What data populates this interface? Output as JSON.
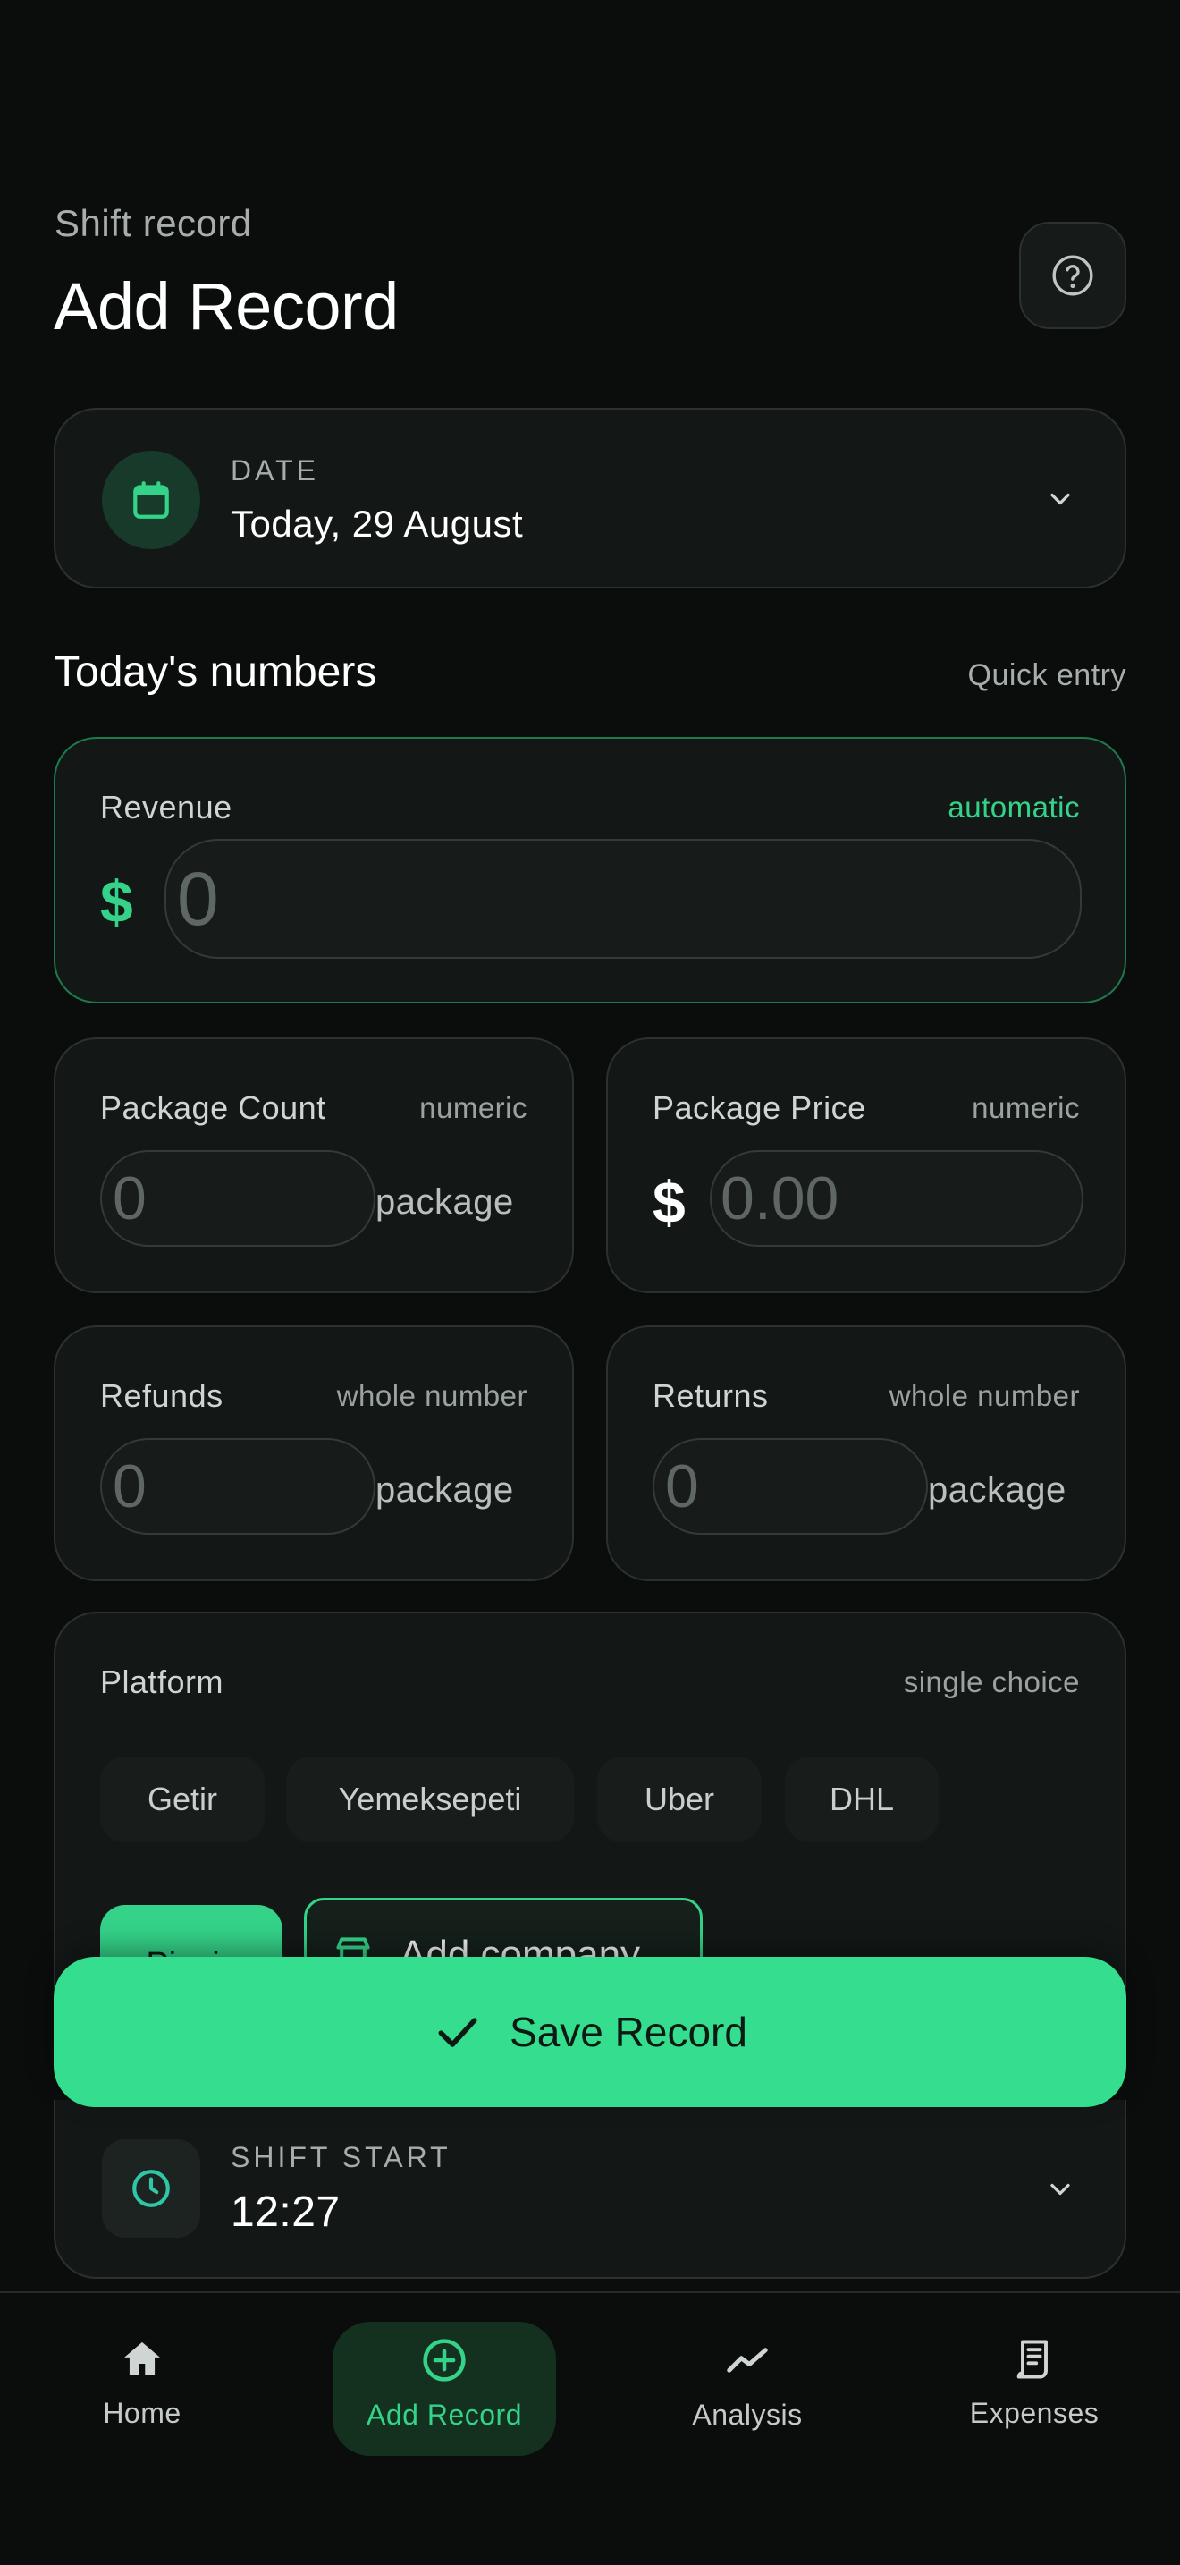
{
  "header": {
    "subtitle": "Shift record",
    "title": "Add Record",
    "help_icon": "help-circle-icon"
  },
  "date": {
    "icon": "calendar-icon",
    "caption": "DATE",
    "value": "Today, 29 August"
  },
  "section": {
    "title": "Today's numbers",
    "aside": "Quick entry"
  },
  "revenue": {
    "label": "Revenue",
    "hint": "automatic",
    "currency": "$",
    "placeholder": "0"
  },
  "package_count": {
    "label": "Package Count",
    "hint": "numeric",
    "placeholder": "0",
    "unit": "package"
  },
  "package_price": {
    "label": "Package Price",
    "hint": "numeric",
    "currency": "$",
    "placeholder": "0.00"
  },
  "refunds": {
    "label": "Refunds",
    "hint": "whole number",
    "placeholder": "0",
    "unit": "package"
  },
  "returns": {
    "label": "Returns",
    "hint": "whole number",
    "placeholder": "0",
    "unit": "package"
  },
  "platform": {
    "label": "Platform",
    "hint": "single choice",
    "options": [
      "Getir",
      "Yemeksepeti",
      "Uber",
      "DHL"
    ],
    "selected": "Picnic",
    "add_label": "Add company"
  },
  "save_button": {
    "label": "Save Record",
    "icon": "check-icon"
  },
  "shift_start": {
    "icon": "clock-icon",
    "caption": "SHIFT START",
    "value": "12:27"
  },
  "nav": {
    "items": [
      {
        "label": "Home",
        "icon": "home-icon"
      },
      {
        "label": "Add Record",
        "icon": "plus-circle-icon",
        "active": true
      },
      {
        "label": "Analysis",
        "icon": "trend-line-icon"
      },
      {
        "label": "Expenses",
        "icon": "receipt-icon"
      }
    ]
  },
  "colors": {
    "background": "#0a0d0c",
    "card": "#131817",
    "accent": "#34d389",
    "save_button": "#34de8e"
  }
}
